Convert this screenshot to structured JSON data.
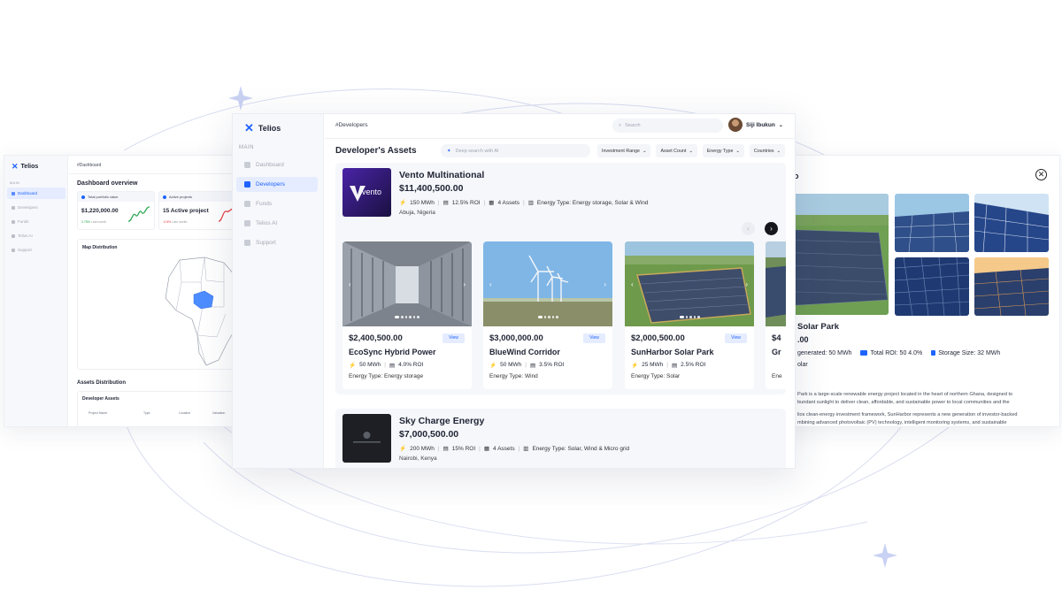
{
  "left_window": {
    "brand": "Telios",
    "section": "MAIN",
    "breadcrumb": "#Dashboard",
    "nav": [
      "Dashboard",
      "Developers",
      "Funds",
      "Telios AI",
      "Support"
    ],
    "title": "Dashboard overview",
    "cards": [
      {
        "label": "Total portfolio value",
        "value": "$1,220,000.00",
        "change": "2.75%",
        "note": "Last month"
      },
      {
        "label": "Active projects",
        "value": "15 Active project",
        "change": "-0.5%",
        "note": "Last month"
      }
    ],
    "map_title": "Map Distribution",
    "assets_title": "Assets Distribution",
    "developer_assets": "Developer Assets",
    "table_headers": [
      "Project Name",
      "Type",
      "Location",
      "Valuation"
    ]
  },
  "main_window": {
    "brand": "Telios",
    "section": "MAIN",
    "nav": [
      {
        "label": "Dashboard",
        "active": false
      },
      {
        "label": "Developers",
        "active": true
      },
      {
        "label": "Funds",
        "active": false
      },
      {
        "label": "Telios AI",
        "active": false
      },
      {
        "label": "Support",
        "active": false
      }
    ],
    "breadcrumb": "#Developers",
    "search_placeholder": "Search",
    "user_name": "Siji Ibukun",
    "page_title": "Developer's Assets",
    "ai_search_placeholder": "Deep search with AI",
    "filters": [
      "Investment Range",
      "Asset Count",
      "Energy Type",
      "Countries"
    ],
    "developers": [
      {
        "name": "Vento Multinational",
        "logo_text": "vento",
        "valuation": "$11,400,500.00",
        "mwh": "150 MWh",
        "roi": "12.5% ROI",
        "assets": "4 Assets",
        "energy": "Energy Type: Energy storage, Solar & Wind",
        "location": "Abuja, Nigeria",
        "assets_list": [
          {
            "price": "$2,400,500.00",
            "name": "EcoSync Hybrid Power",
            "mwh": "50 MWh",
            "roi": "4.0% ROI",
            "type": "Energy Type: Energy storage",
            "view": "View"
          },
          {
            "price": "$3,000,000.00",
            "name": "BlueWind Corridor",
            "mwh": "50 MWh",
            "roi": "3.5% ROI",
            "type": "Energy Type: Wind",
            "view": "View"
          },
          {
            "price": "$2,000,500.00",
            "name": "SunHarbor Solar Park",
            "mwh": "25 MWh",
            "roi": "2.5% ROI",
            "type": "Energy Type: Solar",
            "view": "View"
          },
          {
            "price": "$4",
            "name": "Gr",
            "mwh": "",
            "roi": "",
            "type": "Ene",
            "view": ""
          }
        ]
      },
      {
        "name": "Sky Charge Energy",
        "valuation": "$7,000,500.00",
        "mwh": "200 MWh",
        "roi": "15% ROI",
        "assets": "4 Assets",
        "energy": "Energy Type: Solar, Wind & Micro grid",
        "location": "Nairobi, Kenya"
      }
    ]
  },
  "right_window": {
    "title_fragment": "o",
    "name": "Solar Park",
    "price": ".00",
    "generated": "generated: 50 MWh",
    "roi": "Total ROI: 50 4.0%",
    "storage": "Storage Size: 32 MWh",
    "energy": "olar",
    "desc_1a": "Park is a large-scale renewable energy project located in the heart of northern Ghana, designed to",
    "desc_1b": "bundant sunlight to deliver clean, affordable, and sustainable power to local communities and the",
    "desc_2a": "lios clean-energy investment framework, SunHarbor represents a new generation of investor-backed",
    "desc_2b": "mbining advanced photovoltaic (PV) technology, intelligent monitoring systems, and sustainable"
  },
  "colors": {
    "accent": "#1e63ff",
    "active_bg": "#e5ecff",
    "card_bg": "#f5f7fb"
  }
}
